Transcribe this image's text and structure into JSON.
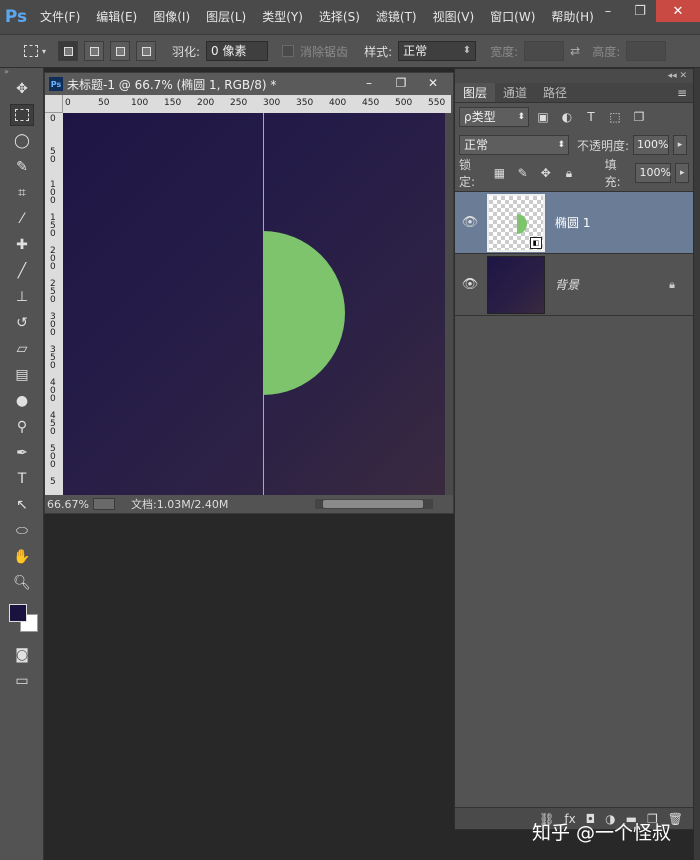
{
  "app": {
    "logo": "Ps"
  },
  "menu": [
    "文件(F)",
    "编辑(E)",
    "图像(I)",
    "图层(L)",
    "类型(Y)",
    "选择(S)",
    "滤镜(T)",
    "视图(V)",
    "窗口(W)",
    "帮助(H)"
  ],
  "window_controls": {
    "minimize": "–",
    "restore": "❐",
    "close": "✕"
  },
  "options": {
    "feather_label": "羽化:",
    "feather_value": "0 像素",
    "antialias_label": "消除锯齿",
    "style_label": "样式:",
    "style_value": "正常",
    "width_label": "宽度:",
    "height_label": "高度:"
  },
  "tools": [
    "move-icon",
    "marquee-icon",
    "lasso-icon",
    "quick-select-icon",
    "crop-icon",
    "eyedropper-icon",
    "healing-icon",
    "brush-icon",
    "stamp-icon",
    "history-brush-icon",
    "eraser-icon",
    "gradient-icon",
    "blur-icon",
    "dodge-icon",
    "pen-icon",
    "type-icon",
    "path-select-icon",
    "ellipse-icon",
    "hand-icon",
    "zoom-icon"
  ],
  "colors": {
    "foreground": "#1a1340",
    "background": "#ffffff",
    "ellipse": "#7dc46c",
    "guide": "#4fc9f5"
  },
  "document": {
    "title": "未标题-1 @ 66.7% (椭圆 1, RGB/8) *",
    "ruler_h": [
      "0",
      "50",
      "100",
      "150",
      "200",
      "250",
      "300",
      "350",
      "400",
      "450",
      "500",
      "550"
    ],
    "ruler_v": [
      "0",
      "5 0",
      "1 0 0",
      "1 5 0",
      "2 0 0",
      "2 5 0",
      "3 0 0",
      "3 5 0",
      "4 0 0",
      "4 5 0",
      "5 0 0",
      "5"
    ],
    "zoom": "66.67%",
    "doc_info": "文档:1.03M/2.40M"
  },
  "layers_panel": {
    "tabs": [
      "图层",
      "通道",
      "路径"
    ],
    "filter_label": "ρ类型",
    "blend_mode": "正常",
    "opacity_label": "不透明度:",
    "opacity_value": "100%",
    "lock_label": "锁定:",
    "fill_label": "填充:",
    "fill_value": "100%",
    "layers": [
      {
        "name": "椭圆 1",
        "selected": true
      },
      {
        "name": "背景",
        "locked": true
      }
    ]
  },
  "watermark": "知乎 @一个怪叔"
}
